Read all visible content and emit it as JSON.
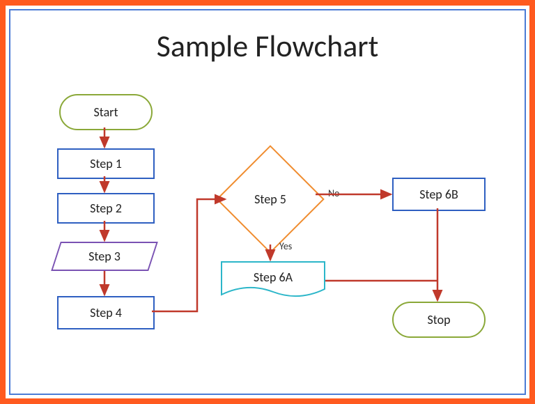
{
  "title": "Sample Flowchart",
  "nodes": {
    "start": {
      "label": "Start"
    },
    "step1": {
      "label": "Step 1"
    },
    "step2": {
      "label": "Step 2"
    },
    "step3": {
      "label": "Step 3"
    },
    "step4": {
      "label": "Step 4"
    },
    "step5": {
      "label": "Step 5"
    },
    "step6a": {
      "label": "Step 6A"
    },
    "step6b": {
      "label": "Step 6B"
    },
    "stop": {
      "label": "Stop"
    }
  },
  "edges": {
    "yes_label": "Yes",
    "no_label": "No"
  },
  "colors": {
    "outer_border": "#ff5a1f",
    "inner_border": "#4a7bd6",
    "terminator": "#8aa838",
    "process": "#2e5fc1",
    "decision": "#f08c2e",
    "data_parallelogram": "#7a52b3",
    "document": "#2bb6c9",
    "arrow": "#c0392b"
  }
}
